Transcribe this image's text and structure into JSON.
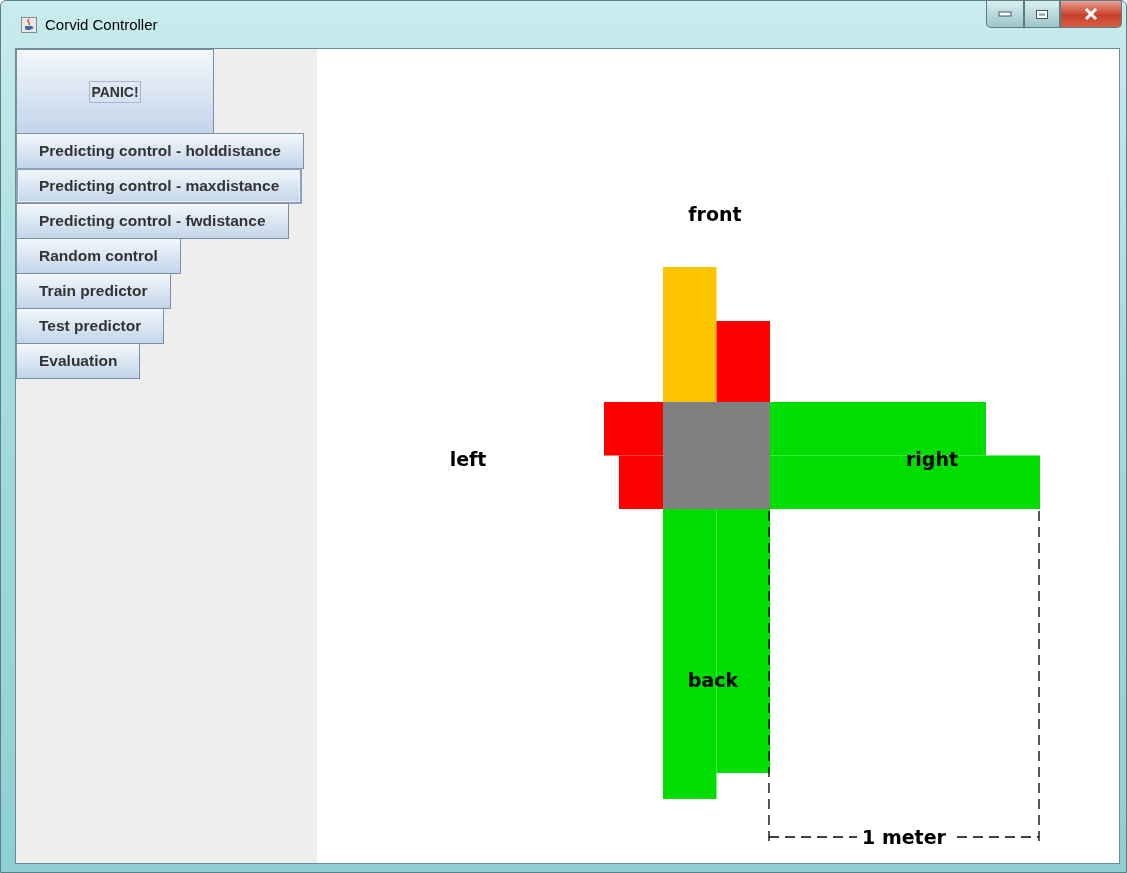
{
  "window": {
    "title": "Corvid Controller"
  },
  "panic_button": {
    "label": "PANIC!",
    "focused": true
  },
  "buttons": [
    {
      "label": "Predicting control - holddistance",
      "hovered": false
    },
    {
      "label": "Predicting control - maxdistance",
      "hovered": true
    },
    {
      "label": "Predicting control - fwdistance",
      "hovered": false
    },
    {
      "label": "Random control",
      "hovered": false
    },
    {
      "label": "Train predictor",
      "hovered": false
    },
    {
      "label": "Test predictor",
      "hovered": false
    },
    {
      "label": "Evaluation",
      "hovered": false
    }
  ],
  "sensors": [
    {
      "kind": "front",
      "label": "front",
      "beams": [
        {
          "color": "#ffc400"
        },
        {
          "color": "#ff0000"
        }
      ]
    },
    {
      "kind": "left",
      "label": "left",
      "beams": [
        {
          "color": "#ff0000"
        },
        {
          "color": "#ff0000"
        }
      ]
    },
    {
      "kind": "right",
      "label": "right",
      "beams": [
        {
          "color": "#00dd00"
        },
        {
          "color": "#00dd00"
        }
      ]
    },
    {
      "kind": "back",
      "label": "back",
      "beams": [
        {
          "color": "#00dd00"
        },
        {
          "color": "#00dd00"
        }
      ]
    }
  ],
  "scale": {
    "label": "1 meter"
  }
}
